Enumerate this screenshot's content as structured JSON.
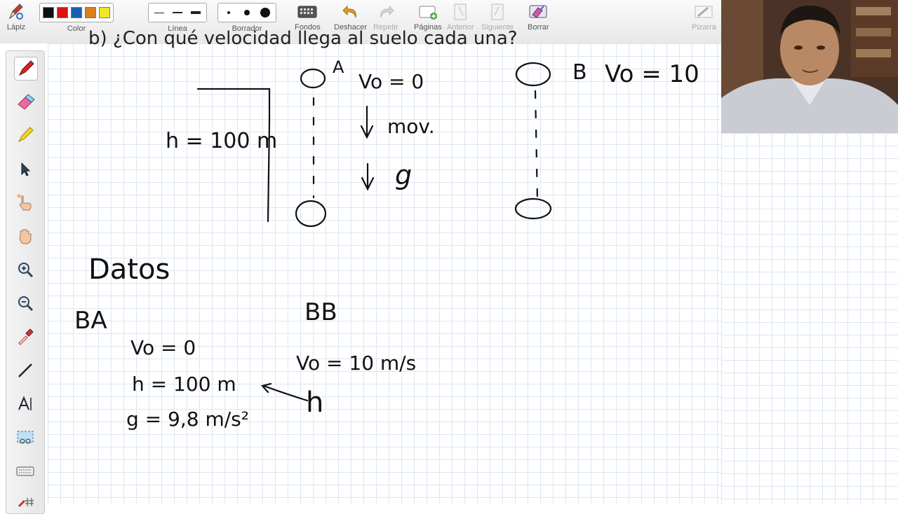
{
  "toolbar": {
    "pencil_label": "Lápiz",
    "color_label": "Color",
    "line_label": "Línea",
    "eraser_label": "Borrador",
    "backgrounds_label": "Fondos",
    "undo_label": "Deshacer",
    "redo_label": "Repetir",
    "pages_label": "Páginas",
    "previous_label": "Anterior",
    "next_label": "Siguiente",
    "clear_label": "Borrar",
    "whiteboard_label": "Pizarra",
    "colors": [
      "#111111",
      "#dd1111",
      "#1b5fae",
      "#d9801a",
      "#f2e62a"
    ]
  },
  "board": {
    "header_text": "b) ¿Con qué velocidad llega al suelo cada una?",
    "height_label": "h = 100 m",
    "ball_a_label": "A",
    "ball_a_v0": "Vo = 0",
    "mov_label": "mov.",
    "g_label": "g",
    "ball_b_label": "B",
    "ball_b_v0": "Vo = 10",
    "datos_title": "Datos",
    "ba_label": "BA",
    "ba_v0": "Vo = 0",
    "ba_h": "h = 100 m",
    "ba_g": "g = 9,8 m/s²",
    "bb_label": "BB",
    "bb_v0": "Vo = 10 m/s",
    "bb_h": "h"
  }
}
